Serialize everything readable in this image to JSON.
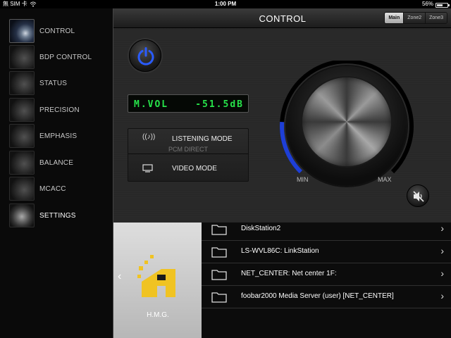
{
  "status_bar": {
    "carrier": "無 SIM 卡",
    "time": "1:00 PM",
    "battery": "56%",
    "battery_level": 0.56
  },
  "sidebar": {
    "items": [
      {
        "label": "CONTROL",
        "icon": "control-thumb-icon",
        "active": true
      },
      {
        "label": "BDP CONTROL",
        "icon": "bdp-control-thumb-icon"
      },
      {
        "label": "STATUS",
        "icon": "status-thumb-icon"
      },
      {
        "label": "PRECISION",
        "icon": "precision-thumb-icon"
      },
      {
        "label": "EMPHASIS",
        "icon": "emphasis-thumb-icon"
      },
      {
        "label": "BALANCE",
        "icon": "balance-thumb-icon"
      },
      {
        "label": "MCACC",
        "icon": "mcacc-thumb-icon"
      },
      {
        "label": "SETTINGS",
        "icon": "settings-gear-icon"
      }
    ]
  },
  "control": {
    "title": "CONTROL",
    "zone_tabs": [
      "Main",
      "Zone2",
      "Zone3"
    ],
    "selected_zone": "Main",
    "volume_label": "M.VOL",
    "volume_value": "-51.5dB",
    "listening_mode_label": "LISTENING MODE",
    "listening_mode_value": "PCM DIRECT",
    "video_mode_label": "VIDEO MODE",
    "knob_min_label": "MIN",
    "knob_max_label": "MAX",
    "volume_level": 0.18
  },
  "source": {
    "name": "H.M.G."
  },
  "browser": {
    "items": [
      "DiskStation2",
      "LS-WVL86C: LinkStation",
      "NET_CENTER: Net center 1F:",
      "foobar2000 Media Server (user) [NET_CENTER]"
    ]
  },
  "colors": {
    "accent_blue": "#1e3fd6",
    "vfd_green": "#27e34a"
  }
}
